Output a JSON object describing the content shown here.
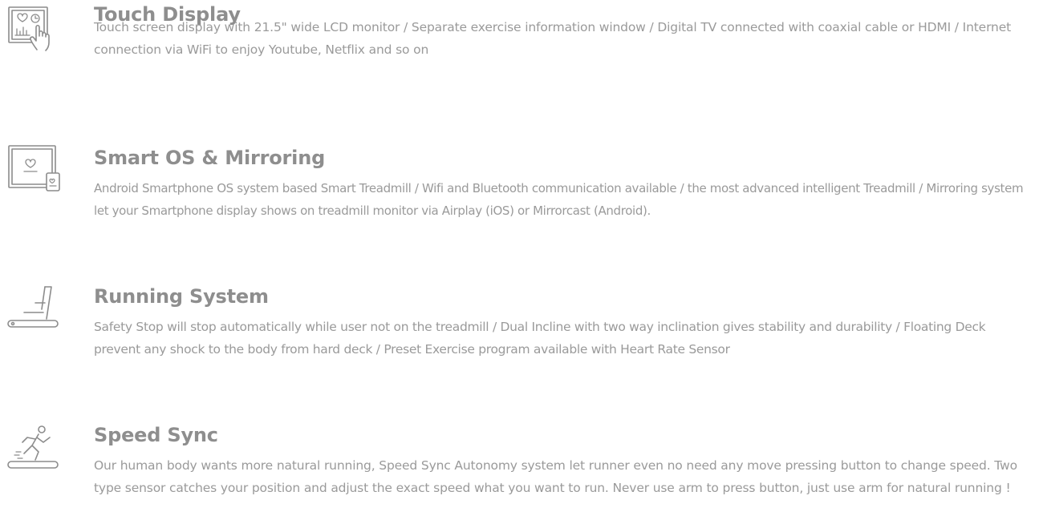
{
  "colors": {
    "title": "#8e8e8e",
    "text": "#9a9a9a",
    "icon_stroke": "#8c8c8c",
    "background": "#ffffff"
  },
  "features": [
    {
      "icon": "touch-display-icon",
      "title": "Touch Display",
      "description": "Touch screen display with 21.5\" wide LCD monitor / Separate exercise information window / Digital TV connected with coaxial cable or HDMI / Internet connection via WiFi to enjoy Youtube, Netflix and so on"
    },
    {
      "icon": "smart-mirroring-icon",
      "title": "Smart OS & Mirroring",
      "description": "Android Smartphone OS system based Smart Treadmill / Wifi and Bluetooth communication available / the most advanced intelligent Treadmill / Mirroring system let your Smartphone display shows on treadmill monitor via Airplay (iOS) or Mirrorcast (Android)."
    },
    {
      "icon": "treadmill-icon",
      "title": "Running System",
      "description": "Safety Stop will stop automatically while user not on the treadmill / Dual Incline with two way inclination gives stability and durability / Floating Deck prevent any shock to the body from hard deck / Preset Exercise program available with Heart Rate Sensor"
    },
    {
      "icon": "runner-on-treadmill-icon",
      "title": "Speed Sync",
      "description": "Our human body wants more natural running, Speed Sync Autonomy system let runner even no need any move pressing button to change speed. Two type sensor catches your position and adjust the exact speed what you want to run. Never use arm to press button, just use arm for natural running !"
    }
  ]
}
